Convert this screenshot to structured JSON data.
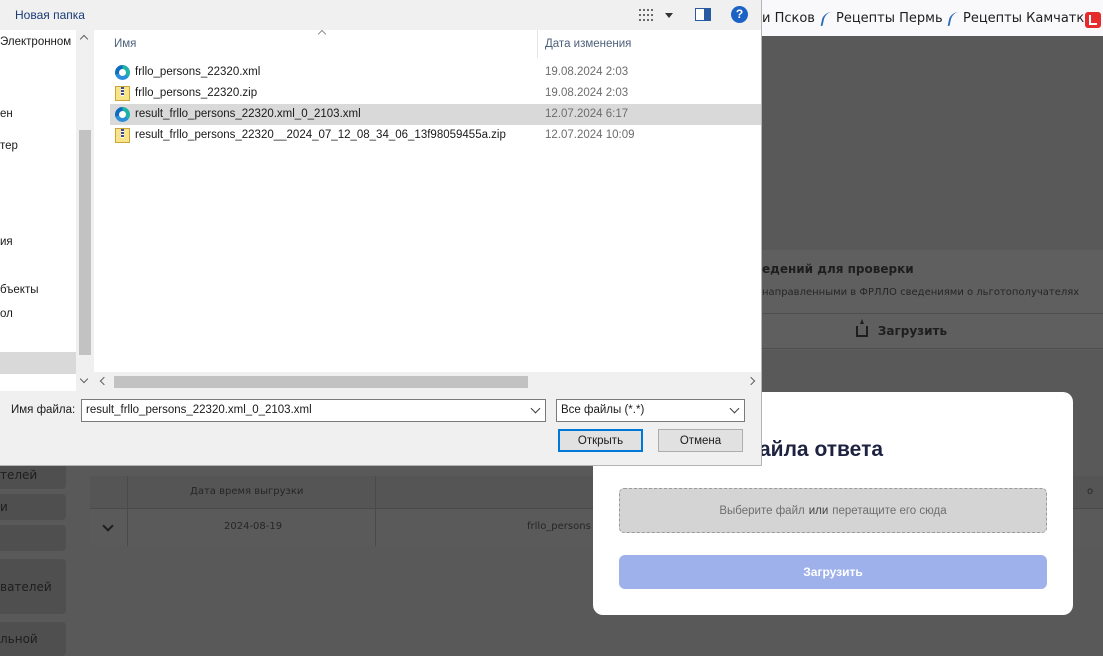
{
  "browser": {
    "bookmarks": [
      "и Псков",
      "Рецепты Пермь",
      "Рецепты Камчатк"
    ]
  },
  "background_app": {
    "upload_card": {
      "title": "едений для проверки",
      "subtitle": "направленными в ФРЛЛО сведениями о льготополучателях",
      "button_label": "Загрузить"
    },
    "left_nav": [
      "телей",
      "и",
      "",
      "вателей",
      "льной"
    ],
    "table": {
      "header_datetime": "Дата время выгрузки",
      "header_right": "о",
      "row_date": "2024-08-19",
      "row_file": "frllo_persons"
    }
  },
  "modal": {
    "title": "айла ответа",
    "dropzone_choose": "Выберите файл",
    "dropzone_or": "или",
    "dropzone_drag": "перетащите его сюда",
    "upload_button": "Загрузить"
  },
  "dialog": {
    "new_folder": "Новая папка",
    "help_label": "?",
    "nav_items": [
      "Электронном",
      "ен",
      "тер",
      "ия",
      "бъекты",
      "ол"
    ],
    "columns": {
      "name": "Имя",
      "date": "Дата изменения"
    },
    "files": [
      {
        "name": "frllo_persons_22320.xml",
        "date": "19.08.2024 2:03",
        "type": "xml"
      },
      {
        "name": "frllo_persons_22320.zip",
        "date": "19.08.2024 2:03",
        "type": "zip"
      },
      {
        "name": "result_frllo_persons_22320.xml_0_2103.xml",
        "date": "12.07.2024 6:17",
        "type": "xml",
        "selected": true
      },
      {
        "name": "result_frllo_persons_22320__2024_07_12_08_34_06_13f98059455a.zip",
        "date": "12.07.2024 10:09",
        "type": "zip"
      }
    ],
    "filename_label": "Имя файла:",
    "filename_value": "result_frllo_persons_22320.xml_0_2103.xml",
    "filetype_value": "Все файлы (*.*)",
    "open_button": "Открыть",
    "cancel_button": "Отмена"
  },
  "colors": {
    "modal_button": "#9fb1ea",
    "selected_row": "#d9d9d9",
    "overlay": "#595959"
  }
}
